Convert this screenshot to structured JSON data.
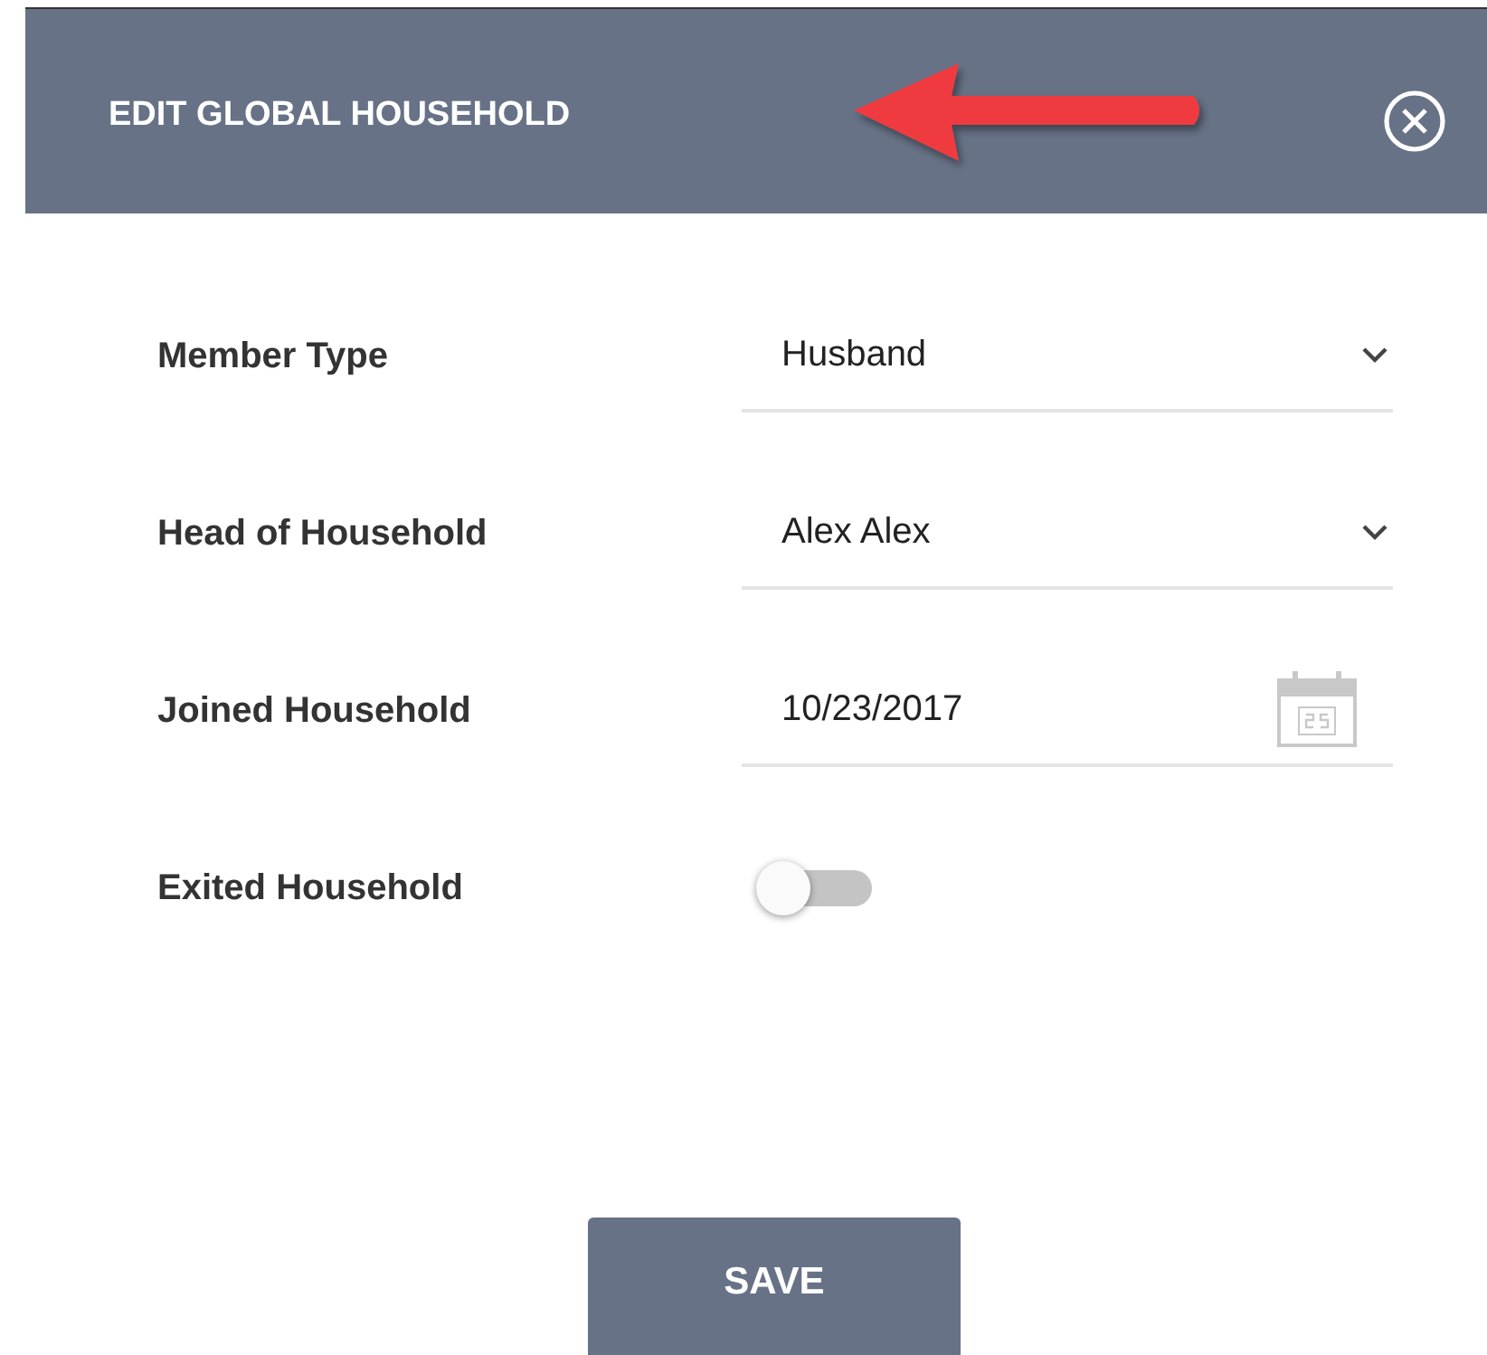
{
  "dialog": {
    "title": "EDIT GLOBAL HOUSEHOLD"
  },
  "fields": [
    {
      "label": "Member Type",
      "kind": "select",
      "value": "Husband"
    },
    {
      "label": "Head of Household",
      "kind": "select",
      "value": "Alex Alex"
    },
    {
      "label": "Joined Household",
      "kind": "date",
      "value": "10/23/2017"
    },
    {
      "label": "Exited Household",
      "kind": "toggle",
      "on": false
    }
  ],
  "buttons": [
    "SAVE"
  ]
}
